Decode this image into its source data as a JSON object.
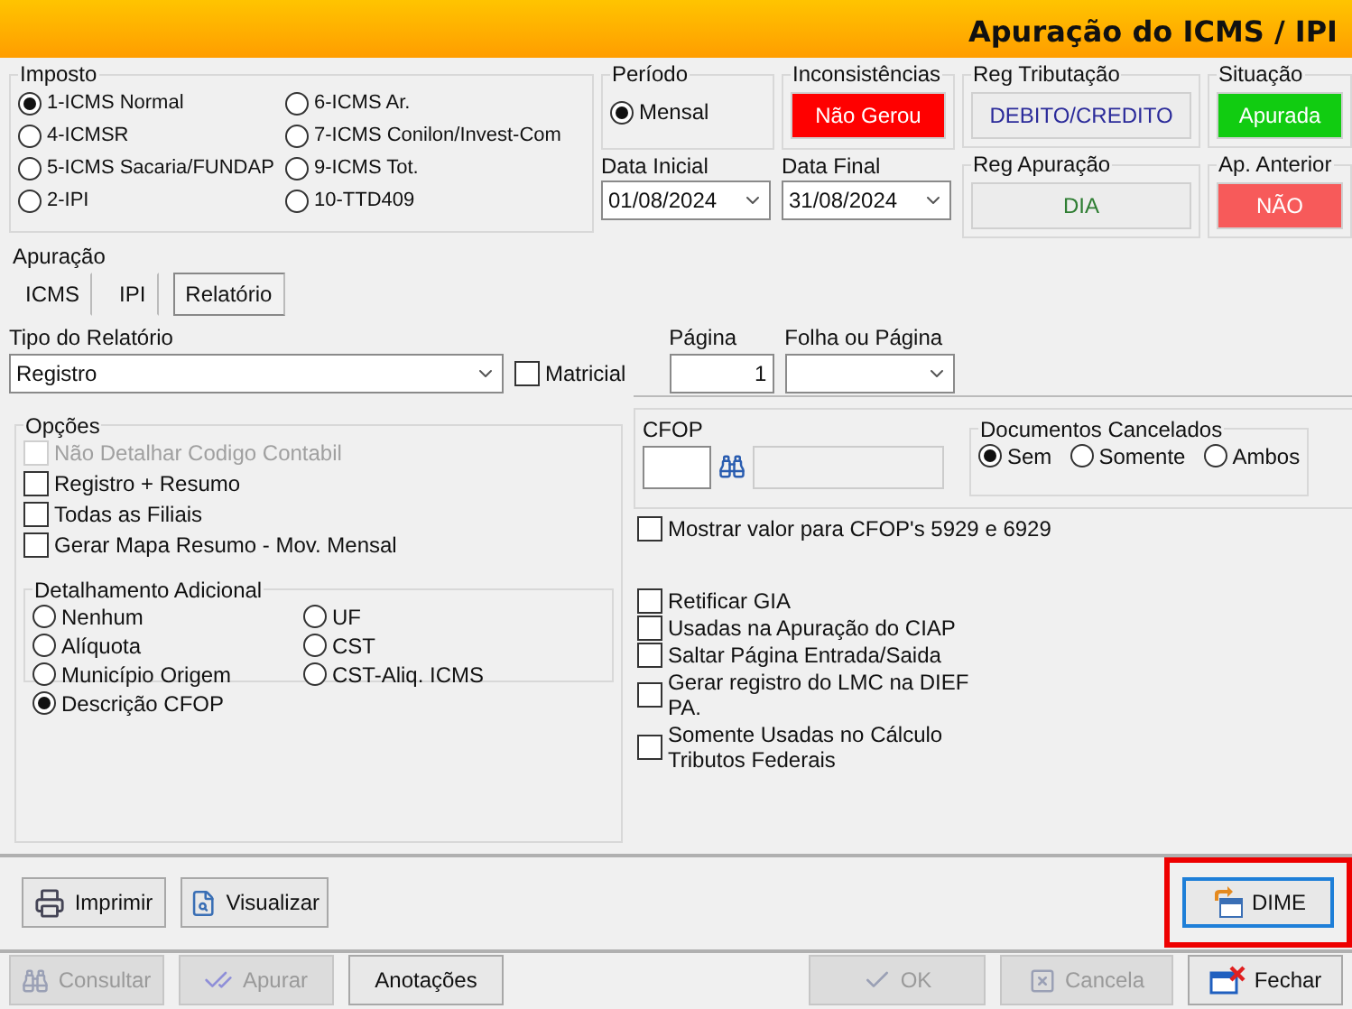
{
  "window": {
    "title": "Apuração do ICMS / IPI"
  },
  "imposto": {
    "label": "Imposto",
    "options": [
      {
        "label": "1-ICMS Normal",
        "selected": true
      },
      {
        "label": "6-ICMS Ar.",
        "selected": false
      },
      {
        "label": "4-ICMSR",
        "selected": false
      },
      {
        "label": "7-ICMS Conilon/Invest-Com",
        "selected": false
      },
      {
        "label": "5-ICMS Sacaria/FUNDAP",
        "selected": false
      },
      {
        "label": "9-ICMS Tot.",
        "selected": false
      },
      {
        "label": "2-IPI",
        "selected": false
      },
      {
        "label": "10-TTD409",
        "selected": false
      }
    ]
  },
  "periodo": {
    "label": "Período",
    "options": [
      {
        "label": "Mensal",
        "selected": true
      }
    ]
  },
  "inconsistencias": {
    "label": "Inconsistências",
    "value": "Não Gerou",
    "color": "#ff0000"
  },
  "dates": [
    {
      "label": "Data Inicial",
      "value": "01/08/2024"
    },
    {
      "label": "Data Final",
      "value": "31/08/2024"
    }
  ],
  "registros": [
    {
      "label": "Reg Tributação",
      "value": "DEBITO/CREDITO",
      "color": "#2b2b9a"
    },
    {
      "label": "Reg Apuração",
      "value": "DIA",
      "color": "#2e7d32"
    }
  ],
  "situacao": [
    {
      "label": "Situação",
      "value": "Apurada",
      "color": "#11cc11"
    },
    {
      "label": "Ap. Anterior",
      "value": "NÃO",
      "color": "#f75a5a"
    }
  ],
  "apuracao": {
    "label": "Apuração",
    "tabs": [
      {
        "label": "ICMS",
        "selected": false
      },
      {
        "label": "IPI",
        "selected": false
      },
      {
        "label": "Relatório",
        "selected": true
      }
    ]
  },
  "relatorio": {
    "label": "Tipo do Relatório",
    "value": "Registro",
    "matricial": {
      "label": "Matricial",
      "checked": false
    },
    "pagina": {
      "label": "Página",
      "value": "1"
    },
    "folha": {
      "label": "Folha ou Página"
    }
  },
  "opcoes": {
    "label": "Opções",
    "checks": [
      {
        "label": "Não Detalhar Codigo Contabil",
        "checked": false,
        "disabled": true
      },
      {
        "label": "Registro + Resumo",
        "checked": false,
        "disabled": false
      },
      {
        "label": "Todas as Filiais",
        "checked": false,
        "disabled": false
      },
      {
        "label": "Gerar Mapa Resumo - Mov. Mensal",
        "checked": false,
        "disabled": false
      }
    ],
    "detalhamento": {
      "label": "Detalhamento Adicional",
      "options": [
        {
          "label": "Nenhum",
          "selected": false
        },
        {
          "label": "UF",
          "selected": false
        },
        {
          "label": "Alíquota",
          "selected": false
        },
        {
          "label": "CST",
          "selected": false
        },
        {
          "label": "Município Origem",
          "selected": false
        },
        {
          "label": "CST-Aliq. ICMS",
          "selected": false
        },
        {
          "label": "Descrição CFOP",
          "selected": true
        }
      ]
    }
  },
  "cfop": {
    "label": "CFOP"
  },
  "documentos": {
    "label": "Documentos Cancelados",
    "options": [
      {
        "label": "Sem",
        "selected": true
      },
      {
        "label": "Somente",
        "selected": false
      },
      {
        "label": "Ambos",
        "selected": false
      }
    ]
  },
  "cfop_check": {
    "label": "Mostrar valor para CFOP's 5929 e 6929",
    "checked": false
  },
  "extra_checks": [
    {
      "label": "Retificar GIA",
      "checked": false
    },
    {
      "label": "Usadas na Apuração do CIAP",
      "checked": false
    },
    {
      "label": "Saltar Página Entrada/Saida",
      "checked": false
    },
    {
      "label": "Gerar registro do LMC na DIEF PA.",
      "checked": false
    },
    {
      "label": "Somente Usadas no Cálculo Tributos Federais",
      "checked": false
    }
  ],
  "action_buttons": [
    {
      "label": "Imprimir",
      "kind": "print"
    },
    {
      "label": "Visualizar",
      "kind": "preview"
    },
    {
      "label": "DIME",
      "kind": "dime",
      "highlighted": true
    }
  ],
  "footer_buttons": [
    {
      "label": "Consultar",
      "kind": "query",
      "disabled": true
    },
    {
      "label": "Apurar",
      "kind": "calc",
      "disabled": true
    },
    {
      "label": "Anotações",
      "kind": "notes",
      "disabled": false
    },
    {
      "label": "OK",
      "kind": "ok",
      "disabled": true
    },
    {
      "label": "Cancela",
      "kind": "cancel",
      "disabled": true
    },
    {
      "label": "Fechar",
      "kind": "close",
      "disabled": false
    }
  ]
}
